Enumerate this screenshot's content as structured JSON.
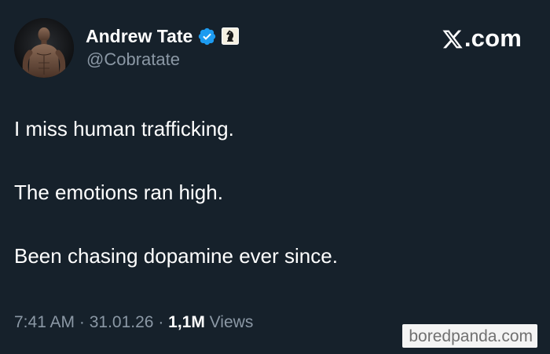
{
  "author": {
    "display_name": "Andrew Tate",
    "handle": "@Cobratate",
    "verified_icon": "verified-badge-icon",
    "affiliate_icon": "chess-knight-badge-icon"
  },
  "branding": {
    "x_domain": ".com"
  },
  "tweet": {
    "lines": [
      "I miss human trafficking.",
      "The emotions ran high.",
      "Been chasing dopamine ever since."
    ]
  },
  "meta": {
    "time": "7:41 AM",
    "separator": " · ",
    "date": "31.01.26",
    "views_count": "1,1M",
    "views_label": " Views"
  },
  "watermark": {
    "text": "boredpanda.com"
  },
  "colors": {
    "background": "#16212b",
    "primary_text": "#ffffff",
    "secondary_text": "#8b98a5",
    "verified_blue": "#1d9bf0",
    "affiliate_badge": "#f5f0e1"
  }
}
